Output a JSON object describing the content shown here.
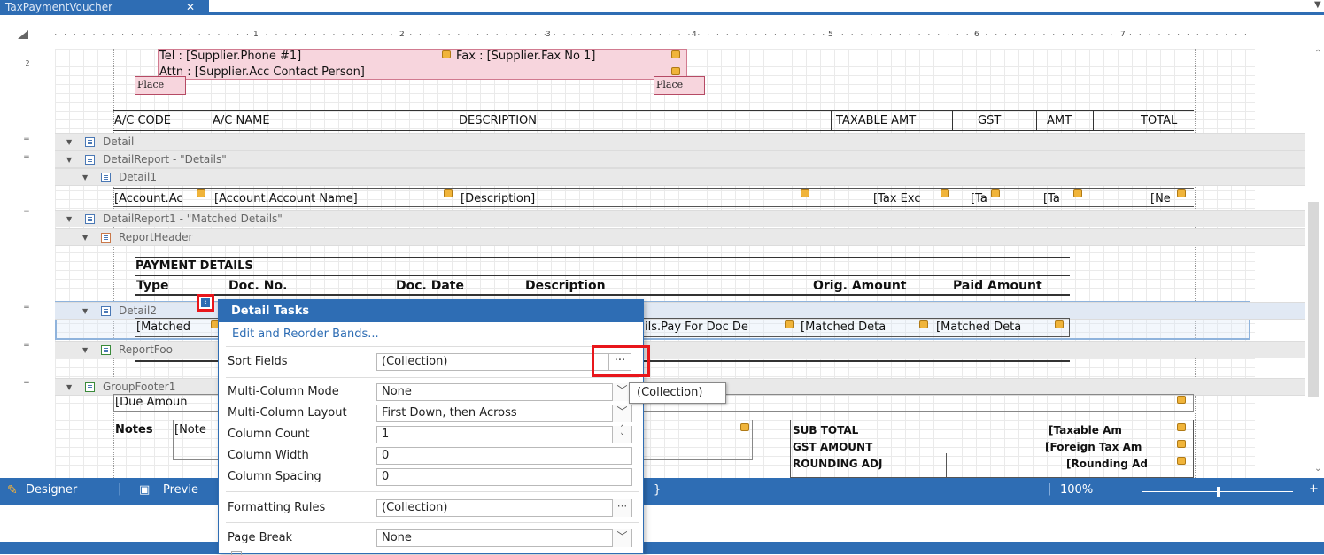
{
  "tab": {
    "title": "TaxPaymentVoucher",
    "close": "✕"
  },
  "ruler": {
    "numbers": [
      "1",
      "2",
      "3",
      "4",
      "5",
      "6",
      "7"
    ],
    "left_mark": "2"
  },
  "header_fields": {
    "tel": "Tel : [Supplier.Phone #1]",
    "fax": "Fax : [Supplier.Fax No 1]",
    "attn": "Attn : [Supplier.Acc Contact Person]",
    "place1": "Place",
    "place2": "Place"
  },
  "columns": [
    "A/C CODE",
    "A/C NAME",
    "DESCRIPTION",
    "TAXABLE AMT",
    "GST",
    "AMT",
    "TOTAL"
  ],
  "bands": {
    "detail": "Detail",
    "detail_report": "DetailReport - \"Details\"",
    "detail1": "Detail1",
    "detail_report1": "DetailReport1 - \"Matched Details\"",
    "report_header": "ReportHeader",
    "detail2": "Detail2",
    "report_footer": "ReportFoo",
    "group_footer1": "GroupFooter1"
  },
  "detail1_fields": [
    "[Account.Ac",
    "[Account.Account Name]",
    "[Description]",
    "[Tax Exc",
    "[Ta",
    "[Ta",
    "[Ne"
  ],
  "payment": {
    "title": "PAYMENT DETAILS",
    "cols": [
      "Type",
      "Doc. No.",
      "Doc. Date",
      "Description",
      "Orig. Amount",
      "Paid Amount"
    ]
  },
  "detail2_fields": {
    "first": "[Matched",
    "mid": "ils.Pay For Doc De",
    "c1": "[Matched Deta",
    "c2": "[Matched Deta"
  },
  "footer": {
    "due": "[Due Amoun",
    "notes": "Notes",
    "notes_field": "[Note",
    "sub_total": "SUB TOTAL",
    "gst_amount": "GST AMOUNT",
    "rounding": "ROUNDING ADJ",
    "taxable": "[Taxable Am",
    "foreign": "[Foreign Tax Am",
    "rounding_val": "[Rounding Ad"
  },
  "popup": {
    "title": "Detail Tasks",
    "link": "Edit and Reorder Bands...",
    "rows": [
      {
        "label": "Sort Fields",
        "value": "(Collection)"
      },
      {
        "label": "Multi-Column Mode",
        "value": "None"
      },
      {
        "label": "Multi-Column Layout",
        "value": "First Down, then Across"
      },
      {
        "label": "Column Count",
        "value": "1"
      },
      {
        "label": "Column Width",
        "value": "0"
      },
      {
        "label": "Column Spacing",
        "value": "0"
      },
      {
        "label": "Formatting Rules",
        "value": "(Collection)"
      },
      {
        "label": "Page Break",
        "value": "None"
      }
    ],
    "ellipsis": "···",
    "tooltip": "(Collection)"
  },
  "statusbar": {
    "designer": "Designer",
    "preview": "Previe",
    "brace": "}",
    "zoom": "100%",
    "minus": "—",
    "plus": "+"
  },
  "colors": {
    "accent": "#2e6db4",
    "highlight": "#e8161b",
    "place_fill": "#f7d5dd"
  }
}
